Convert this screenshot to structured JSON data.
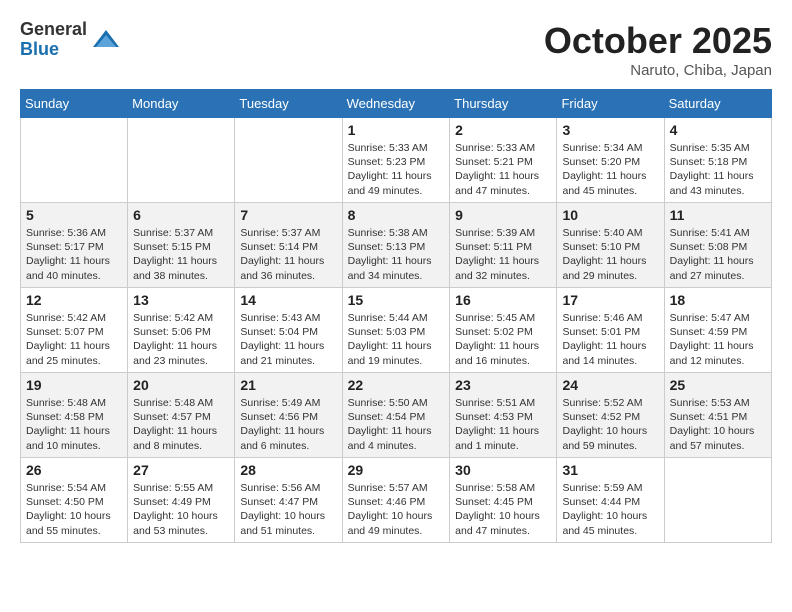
{
  "header": {
    "logo_general": "General",
    "logo_blue": "Blue",
    "month_title": "October 2025",
    "location": "Naruto, Chiba, Japan"
  },
  "days_of_week": [
    "Sunday",
    "Monday",
    "Tuesday",
    "Wednesday",
    "Thursday",
    "Friday",
    "Saturday"
  ],
  "weeks": [
    [
      {
        "day": "",
        "info": ""
      },
      {
        "day": "",
        "info": ""
      },
      {
        "day": "",
        "info": ""
      },
      {
        "day": "1",
        "info": "Sunrise: 5:33 AM\nSunset: 5:23 PM\nDaylight: 11 hours\nand 49 minutes."
      },
      {
        "day": "2",
        "info": "Sunrise: 5:33 AM\nSunset: 5:21 PM\nDaylight: 11 hours\nand 47 minutes."
      },
      {
        "day": "3",
        "info": "Sunrise: 5:34 AM\nSunset: 5:20 PM\nDaylight: 11 hours\nand 45 minutes."
      },
      {
        "day": "4",
        "info": "Sunrise: 5:35 AM\nSunset: 5:18 PM\nDaylight: 11 hours\nand 43 minutes."
      }
    ],
    [
      {
        "day": "5",
        "info": "Sunrise: 5:36 AM\nSunset: 5:17 PM\nDaylight: 11 hours\nand 40 minutes."
      },
      {
        "day": "6",
        "info": "Sunrise: 5:37 AM\nSunset: 5:15 PM\nDaylight: 11 hours\nand 38 minutes."
      },
      {
        "day": "7",
        "info": "Sunrise: 5:37 AM\nSunset: 5:14 PM\nDaylight: 11 hours\nand 36 minutes."
      },
      {
        "day": "8",
        "info": "Sunrise: 5:38 AM\nSunset: 5:13 PM\nDaylight: 11 hours\nand 34 minutes."
      },
      {
        "day": "9",
        "info": "Sunrise: 5:39 AM\nSunset: 5:11 PM\nDaylight: 11 hours\nand 32 minutes."
      },
      {
        "day": "10",
        "info": "Sunrise: 5:40 AM\nSunset: 5:10 PM\nDaylight: 11 hours\nand 29 minutes."
      },
      {
        "day": "11",
        "info": "Sunrise: 5:41 AM\nSunset: 5:08 PM\nDaylight: 11 hours\nand 27 minutes."
      }
    ],
    [
      {
        "day": "12",
        "info": "Sunrise: 5:42 AM\nSunset: 5:07 PM\nDaylight: 11 hours\nand 25 minutes."
      },
      {
        "day": "13",
        "info": "Sunrise: 5:42 AM\nSunset: 5:06 PM\nDaylight: 11 hours\nand 23 minutes."
      },
      {
        "day": "14",
        "info": "Sunrise: 5:43 AM\nSunset: 5:04 PM\nDaylight: 11 hours\nand 21 minutes."
      },
      {
        "day": "15",
        "info": "Sunrise: 5:44 AM\nSunset: 5:03 PM\nDaylight: 11 hours\nand 19 minutes."
      },
      {
        "day": "16",
        "info": "Sunrise: 5:45 AM\nSunset: 5:02 PM\nDaylight: 11 hours\nand 16 minutes."
      },
      {
        "day": "17",
        "info": "Sunrise: 5:46 AM\nSunset: 5:01 PM\nDaylight: 11 hours\nand 14 minutes."
      },
      {
        "day": "18",
        "info": "Sunrise: 5:47 AM\nSunset: 4:59 PM\nDaylight: 11 hours\nand 12 minutes."
      }
    ],
    [
      {
        "day": "19",
        "info": "Sunrise: 5:48 AM\nSunset: 4:58 PM\nDaylight: 11 hours\nand 10 minutes."
      },
      {
        "day": "20",
        "info": "Sunrise: 5:48 AM\nSunset: 4:57 PM\nDaylight: 11 hours\nand 8 minutes."
      },
      {
        "day": "21",
        "info": "Sunrise: 5:49 AM\nSunset: 4:56 PM\nDaylight: 11 hours\nand 6 minutes."
      },
      {
        "day": "22",
        "info": "Sunrise: 5:50 AM\nSunset: 4:54 PM\nDaylight: 11 hours\nand 4 minutes."
      },
      {
        "day": "23",
        "info": "Sunrise: 5:51 AM\nSunset: 4:53 PM\nDaylight: 11 hours\nand 1 minute."
      },
      {
        "day": "24",
        "info": "Sunrise: 5:52 AM\nSunset: 4:52 PM\nDaylight: 10 hours\nand 59 minutes."
      },
      {
        "day": "25",
        "info": "Sunrise: 5:53 AM\nSunset: 4:51 PM\nDaylight: 10 hours\nand 57 minutes."
      }
    ],
    [
      {
        "day": "26",
        "info": "Sunrise: 5:54 AM\nSunset: 4:50 PM\nDaylight: 10 hours\nand 55 minutes."
      },
      {
        "day": "27",
        "info": "Sunrise: 5:55 AM\nSunset: 4:49 PM\nDaylight: 10 hours\nand 53 minutes."
      },
      {
        "day": "28",
        "info": "Sunrise: 5:56 AM\nSunset: 4:47 PM\nDaylight: 10 hours\nand 51 minutes."
      },
      {
        "day": "29",
        "info": "Sunrise: 5:57 AM\nSunset: 4:46 PM\nDaylight: 10 hours\nand 49 minutes."
      },
      {
        "day": "30",
        "info": "Sunrise: 5:58 AM\nSunset: 4:45 PM\nDaylight: 10 hours\nand 47 minutes."
      },
      {
        "day": "31",
        "info": "Sunrise: 5:59 AM\nSunset: 4:44 PM\nDaylight: 10 hours\nand 45 minutes."
      },
      {
        "day": "",
        "info": ""
      }
    ]
  ]
}
